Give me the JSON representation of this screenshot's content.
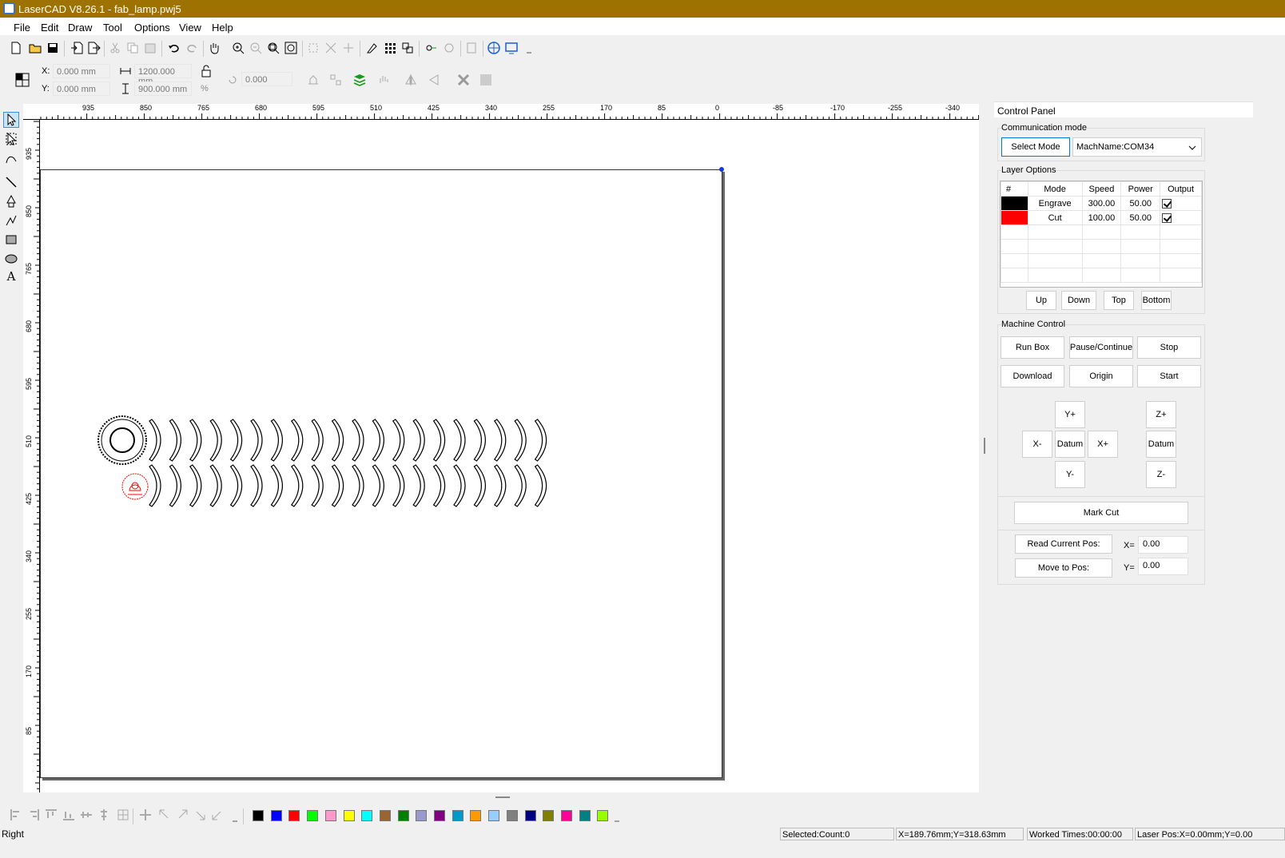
{
  "window": {
    "title": "LaserCAD V8.26.1 - fab_lamp.pwj5"
  },
  "menu": [
    "File",
    "Edit",
    "Draw",
    "Tool",
    "Options",
    "View",
    "Help"
  ],
  "position": {
    "x_label": "X:",
    "x_value": "0.000 mm",
    "y_label": "Y:",
    "y_value": "0.000 mm",
    "width_value": "1200.000 mm",
    "height_value": "900.000 mm",
    "percent": "%",
    "rotation_value": "0.000"
  },
  "ruler": {
    "horizontal": [
      "935",
      "850",
      "765",
      "680",
      "595",
      "510",
      "425",
      "340",
      "255",
      "170",
      "85",
      "0",
      "-85",
      "-170",
      "-255",
      "-340"
    ],
    "vertical": [
      "935",
      "850",
      "765",
      "680",
      "595",
      "510",
      "425",
      "340",
      "255",
      "170",
      "85"
    ]
  },
  "panel": {
    "title": "Control Panel",
    "comm_mode_label": "Communication mode",
    "select_mode": "Select Mode",
    "machine_name": "MachName:COM34",
    "layer_options_label": "Layer Options",
    "layer_headers": [
      "#",
      "Mode",
      "Speed",
      "Power",
      "Output"
    ],
    "layers": [
      {
        "color": "#000000",
        "mode": "Engrave",
        "speed": "300.00",
        "power": "50.00"
      },
      {
        "color": "#ff0000",
        "mode": "Cut",
        "speed": "100.00",
        "power": "50.00"
      }
    ],
    "layer_buttons": [
      "Up",
      "Down",
      "Top",
      "Bottom"
    ],
    "machine_control_label": "Machine Control",
    "run_box": "Run Box",
    "pause_continue": "Pause/Continue",
    "stop": "Stop",
    "download": "Download",
    "origin": "Origin",
    "start": "Start",
    "y_plus": "Y+",
    "y_minus": "Y-",
    "x_minus": "X-",
    "x_plus": "X+",
    "datum": "Datum",
    "z_plus": "Z+",
    "z_minus": "Z-",
    "mark_cut": "Mark Cut",
    "read_pos": "Read Current Pos:",
    "move_pos": "Move to Pos:",
    "x_eq": "X=",
    "y_eq": "Y=",
    "x_val": "0.00",
    "y_val": "0.00"
  },
  "palette": [
    "#000000",
    "#0000ff",
    "#ff0000",
    "#00ff00",
    "#ff99cc",
    "#ffff00",
    "#00ffff",
    "#996633",
    "#008000",
    "#9999cc",
    "#800080",
    "#0099cc",
    "#ff9900",
    "#99ccff",
    "#808080",
    "#000080",
    "#808000",
    "#ff0099",
    "#008080",
    "#99ff00"
  ],
  "status": {
    "left": "Right",
    "selected": "Selected:Count:0",
    "coords": "X=189.76mm;Y=318.63mm",
    "worked": "Worked Times:00:00:00",
    "laser": "Laser Pos:X=0.00mm;Y=0.00"
  }
}
